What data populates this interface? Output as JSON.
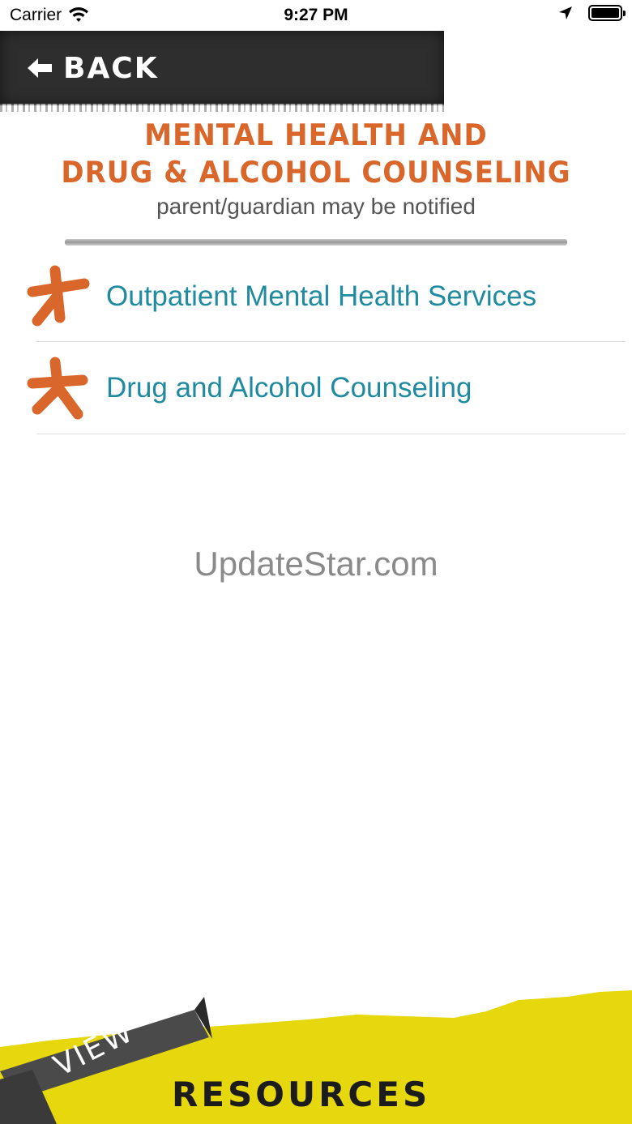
{
  "status_bar": {
    "carrier": "Carrier",
    "time": "9:27 PM"
  },
  "header": {
    "back_label": "BACK"
  },
  "title": {
    "line1": "MENTAL HEALTH AND",
    "line2": "DRUG & ALCOHOL COUNSELING",
    "subtitle": "parent/guardian may be notified"
  },
  "list": {
    "items": [
      {
        "label": "Outpatient Mental Health Services"
      },
      {
        "label": "Drug and Alcohol Counseling"
      }
    ]
  },
  "watermark": "UpdateStar.com",
  "footer": {
    "ribbon_label": "VIEW",
    "main_label": "RESOURCES"
  },
  "colors": {
    "accent_orange": "#d9662a",
    "link_teal": "#1f8aa0",
    "footer_yellow": "#e6d80d",
    "banner_dark": "#2e2e2e"
  }
}
